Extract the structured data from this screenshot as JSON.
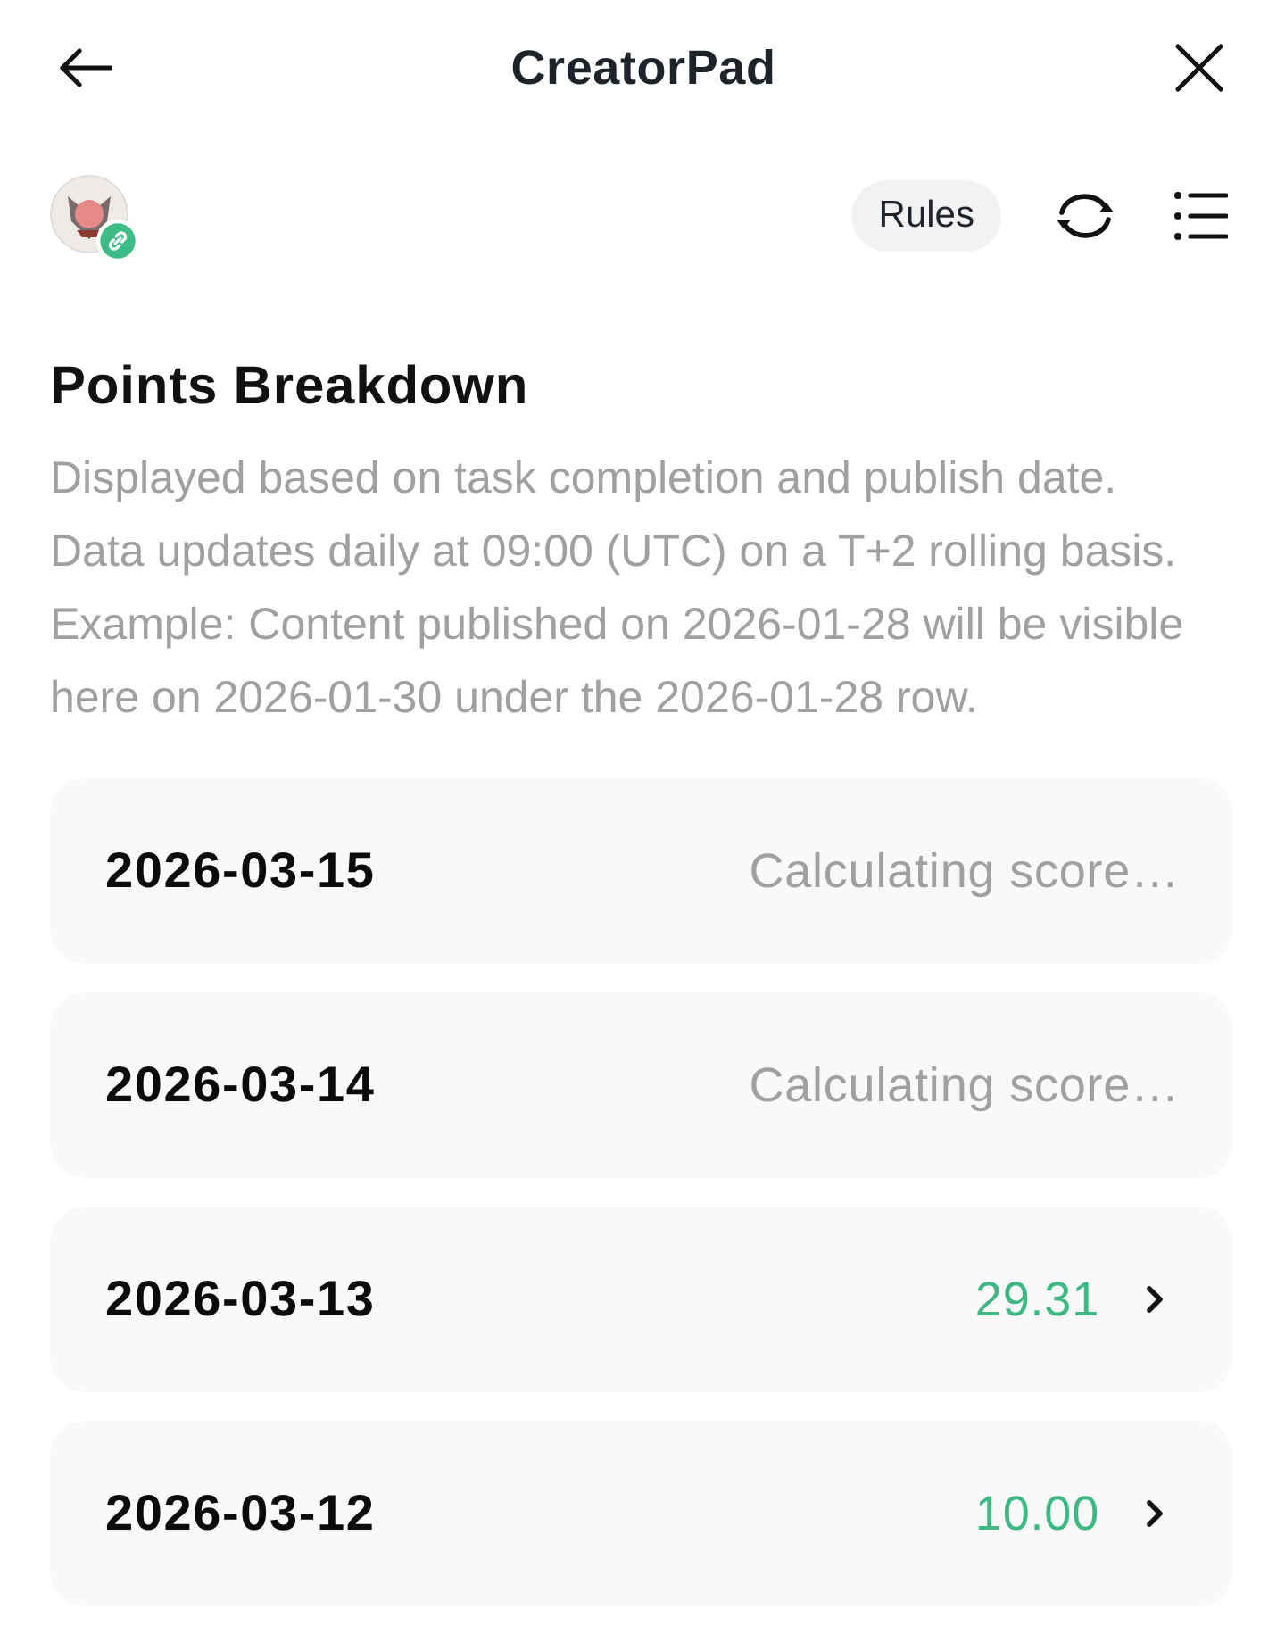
{
  "header": {
    "title": "CreatorPad"
  },
  "toolbar": {
    "rules_button": "Rules"
  },
  "section": {
    "title": "Points Breakdown",
    "description": [
      "Displayed based on task completion and publish date.",
      "Data updates daily at 09:00 (UTC) on a T+2 rolling basis.",
      "Example: Content published on 2026-01-28 will be visible here on 2026-01-30 under the 2026-01-28 row."
    ]
  },
  "rows": [
    {
      "date": "2026-03-15",
      "value": "Calculating score…",
      "kind": "pending"
    },
    {
      "date": "2026-03-14",
      "value": "Calculating score…",
      "kind": "pending"
    },
    {
      "date": "2026-03-13",
      "value": "29.31",
      "kind": "scored"
    },
    {
      "date": "2026-03-12",
      "value": "10.00",
      "kind": "scored"
    }
  ]
}
